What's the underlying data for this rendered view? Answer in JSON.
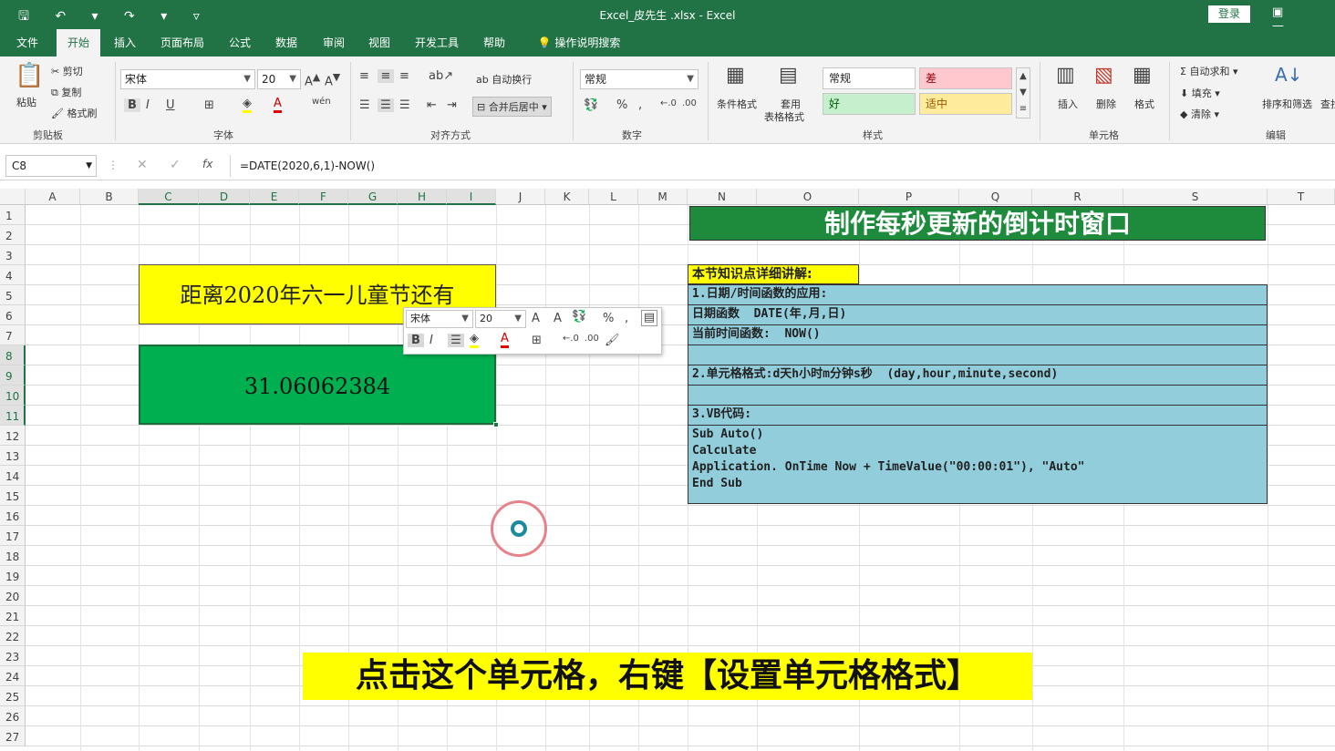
{
  "window": {
    "title": "Excel_皮先生 .xlsx  -  Excel",
    "login_label": "登录",
    "quick_access": "🖫 ↶ ▾ ↷ ▾ ▿",
    "win_controls": "▣ —"
  },
  "menu": {
    "tabs": [
      "文件",
      "开始",
      "插入",
      "页面布局",
      "公式",
      "数据",
      "审阅",
      "视图",
      "开发工具",
      "帮助",
      "操作说明搜索"
    ],
    "active": "开始"
  },
  "ribbon": {
    "clipboard": {
      "paste": "粘贴",
      "cut": "剪切",
      "copy": "复制",
      "format_painter": "格式刷",
      "label": "剪贴板"
    },
    "font": {
      "name": "宋体",
      "size": "20",
      "label": "字体"
    },
    "alignment": {
      "wrap": "自动换行",
      "merge": "合并后居中",
      "label": "对齐方式"
    },
    "number": {
      "format": "常规",
      "label": "数字"
    },
    "styles": {
      "conditional": "条件格式",
      "table_format_1": "套用",
      "table_format_2": "表格格式",
      "normal": "常规",
      "bad": "差",
      "good": "好",
      "neutral": "适中",
      "label": "样式"
    },
    "cells": {
      "insert": "插入",
      "delete": "删除",
      "format": "格式",
      "label": "单元格"
    },
    "editing": {
      "autosum": "自动求和",
      "fill": "填充",
      "clear": "清除",
      "sort": "排序和筛选",
      "find": "查找",
      "label": "编辑"
    }
  },
  "formula_bar": {
    "cell_ref": "C8",
    "formula": "=DATE(2020,6,1)-NOW()",
    "fx": "fx"
  },
  "columns": [
    "A",
    "B",
    "C",
    "D",
    "E",
    "F",
    "G",
    "H",
    "I",
    "J",
    "K",
    "L",
    "M",
    "N",
    "O",
    "P",
    "Q",
    "R",
    "S",
    "T"
  ],
  "rows": [
    "1",
    "2",
    "3",
    "4",
    "5",
    "6",
    "7",
    "8",
    "9",
    "10",
    "11",
    "12",
    "13",
    "14",
    "15",
    "16",
    "17",
    "18",
    "19",
    "20",
    "21",
    "22",
    "23",
    "24",
    "25",
    "26",
    "27"
  ],
  "sheet": {
    "title_cell": "距离2020年六一儿童节还有",
    "value_cell": "31.06062384",
    "banner": "制作每秒更新的倒计时窗口",
    "knowledge_title": "本节知识点详细讲解:",
    "lines": [
      "1.日期/时间函数的应用:",
      "日期函数  DATE(年,月,日)",
      "当前时间函数:  NOW()",
      "",
      "2.单元格格式:d天h小时m分钟s秒  (day,hour,minute,second)",
      "",
      "3.VB代码:"
    ],
    "code": [
      "Sub Auto()",
      "Calculate",
      "Application. OnTime Now + TimeValue(\"00:00:01\"), \"Auto\"",
      "End Sub"
    ]
  },
  "mini_toolbar": {
    "font": "宋体",
    "size": "20"
  },
  "caption": "点击这个单元格，右键【设置单元格格式】",
  "colors": {
    "excel_green": "#217346",
    "title_fill": "#ffff00",
    "value_fill": "#00b050",
    "banner_fill": "#1d8a3c",
    "info_fill": "#92cddc"
  }
}
